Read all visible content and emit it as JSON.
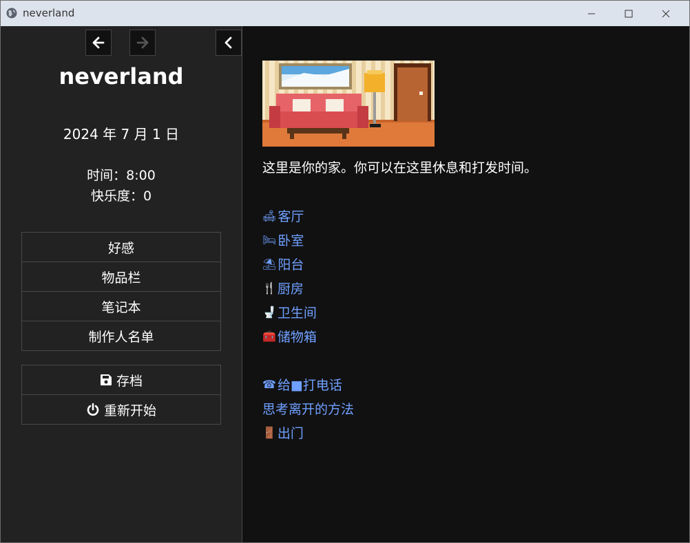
{
  "window": {
    "title": "neverland"
  },
  "sidebar": {
    "story_title": "neverland",
    "date": "2024 年 7 月 1 日",
    "time": "时间：8:00",
    "happiness": "快乐度：0",
    "menu": [
      {
        "label": "好感"
      },
      {
        "label": "物品栏"
      },
      {
        "label": "笔记本"
      },
      {
        "label": "制作人名单"
      }
    ],
    "actions": [
      {
        "label": "存档",
        "icon": "floppy-disk-icon"
      },
      {
        "label": "重新开始",
        "icon": "power-icon"
      }
    ]
  },
  "main": {
    "description": "这里是你的家。你可以在这里休息和打发时间。",
    "rooms": [
      {
        "label": "客厅",
        "emoji": "🛋",
        "icon": "sofa-icon"
      },
      {
        "label": "卧室",
        "emoji": "🛏",
        "icon": "bed-icon"
      },
      {
        "label": "阳台",
        "emoji": "⛱",
        "icon": "umbrella-icon"
      },
      {
        "label": "厨房",
        "emoji": "🍴",
        "icon": "fork-knife-icon"
      },
      {
        "label": "卫生间",
        "emoji": "🚽",
        "icon": "toilet-icon"
      },
      {
        "label": "储物箱",
        "emoji": "🧰",
        "icon": "toolbox-icon"
      }
    ],
    "actions": [
      {
        "label": "给■打电话",
        "emoji": "☎",
        "icon": "telephone-icon"
      },
      {
        "label": "思考离开的方法",
        "emoji": "",
        "icon": ""
      },
      {
        "label": "出门",
        "emoji": "🚪",
        "icon": "door-icon"
      }
    ]
  },
  "colors": {
    "link": "#6fa0ff",
    "sidebar_bg": "#222222",
    "main_bg": "#111111"
  }
}
